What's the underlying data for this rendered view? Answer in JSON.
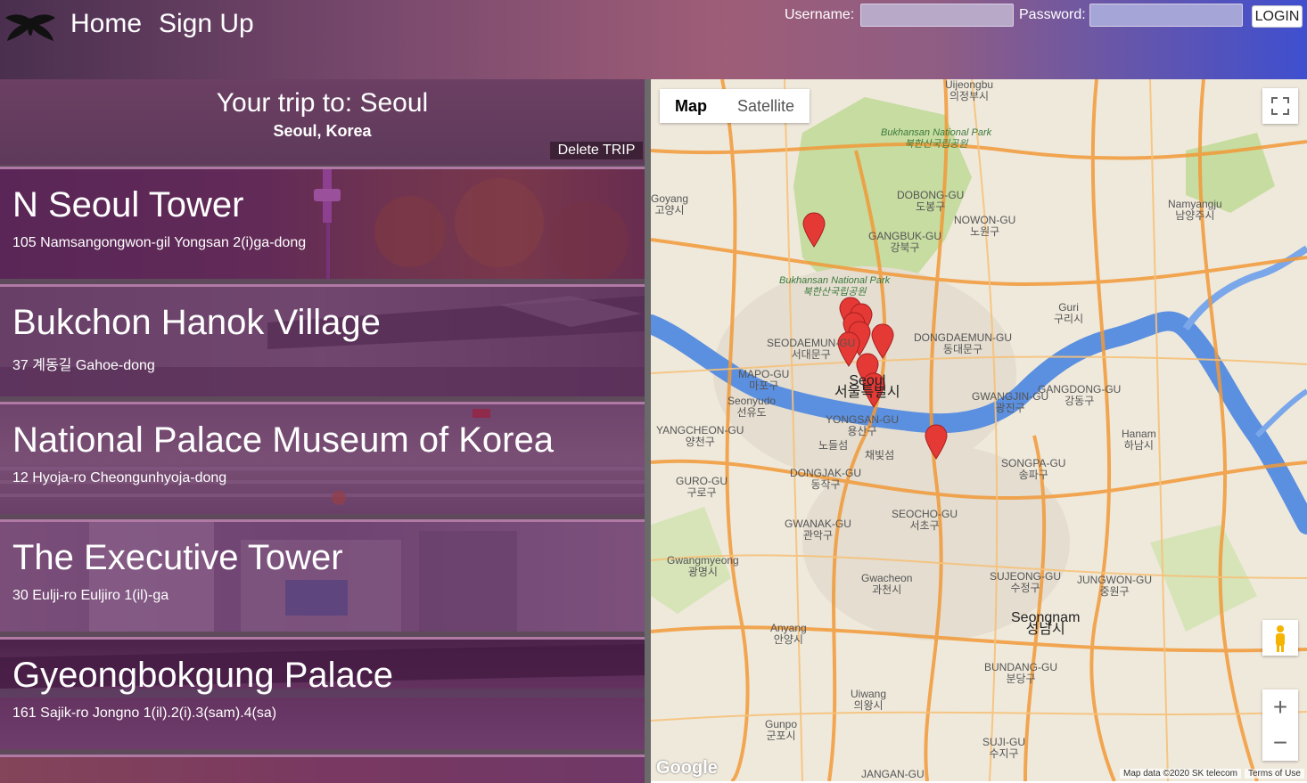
{
  "nav": {
    "home": "Home",
    "signup": "Sign Up"
  },
  "login": {
    "username_label": "Username:",
    "password_label": "Password:",
    "button": "LOGIN"
  },
  "trip": {
    "title": "Your trip to: Seoul",
    "location": "Seoul, Korea",
    "delete_button": "Delete TRIP"
  },
  "places": [
    {
      "name": "N Seoul Tower",
      "address": "105 Namsangongwon-gil Yongsan 2(i)ga-dong"
    },
    {
      "name": "Bukchon Hanok Village",
      "address": "37 계동길 Gahoe-dong"
    },
    {
      "name": "National Palace Museum of Korea",
      "address": "12 Hyoja-ro Cheongunhyoja-dong"
    },
    {
      "name": "The Executive Tower",
      "address": "30 Eulji-ro Euljiro 1(il)-ga"
    },
    {
      "name": "Gyeongbokgung Palace",
      "address": "161 Sajik-ro Jongno 1(il).2(i).3(sam).4(sa)"
    }
  ],
  "map": {
    "type_map": "Map",
    "type_satellite": "Satellite",
    "zoom_in": "+",
    "zoom_out": "−",
    "data_credit": "Map data ©2020 SK telecom",
    "terms": "Terms of Use",
    "google": "Google",
    "labels": {
      "uijeongbu": "Uijeongbu\n의정부시",
      "bukhansan": "Bukhansan National Park\n북한산국립공원",
      "goyang": "Goyang\n고양시",
      "dobong": "DOBONG-GU\n도봉구",
      "gangbuk": "GANGBUK-GU\n강북구",
      "nowon": "NOWON-GU\n노원구",
      "namyangju": "Namyangju\n남양주시",
      "guri": "Guri\n구리시",
      "seodaemun": "SEODAEMUN-GU\n서대문구",
      "dongdaemun": "DONGDAEMUN-GU\n동대문구",
      "mapo": "MAPO-GU\n마포구",
      "seonyudo": "Seonyudo\n선유도",
      "seoul": "Seoul\n서울특별시",
      "yongsan": "YONGSAN-GU\n용산구",
      "gwangjin": "GWANGJIN-GU\n광진구",
      "gangdong": "GANGDONG-GU\n강동구",
      "yangcheon": "YANGCHEON-GU\n양천구",
      "nodeulseom": "노들섬",
      "chaebitseom": "채빛섬",
      "hanam": "Hanam\n하남시",
      "songpa": "SONGPA-GU\n송파구",
      "guro": "GURO-GU\n구로구",
      "dongjak": "DONGJAK-GU\n동작구",
      "gwanak": "GWANAK-GU\n관악구",
      "seocho": "SEOCHO-GU\n서초구",
      "gwangmyeong": "Gwangmyeong\n광명시",
      "gwacheon": "Gwacheon\n과천시",
      "sujeong": "SUJEONG-GU\n수정구",
      "jungwon": "JUNGWON-GU\n중원구",
      "seongnam": "Seongnam\n성남시",
      "anyang": "Anyang\n안양시",
      "bundang": "BUNDANG-GU\n분당구",
      "uiwang": "Uiwang\n의왕시",
      "gunpo": "Gunpo\n군포시",
      "suji": "SUJI-GU\n수지구",
      "jangan": "JANGAN-GU"
    }
  },
  "colors": {
    "header_start": "#4a2f4f",
    "header_end": "#3f4fcf",
    "card_tint": "#5a1e5a",
    "river": "#5b8fe0",
    "road_major": "#f29a38",
    "park": "#c6dca0",
    "marker": "#e53935"
  }
}
